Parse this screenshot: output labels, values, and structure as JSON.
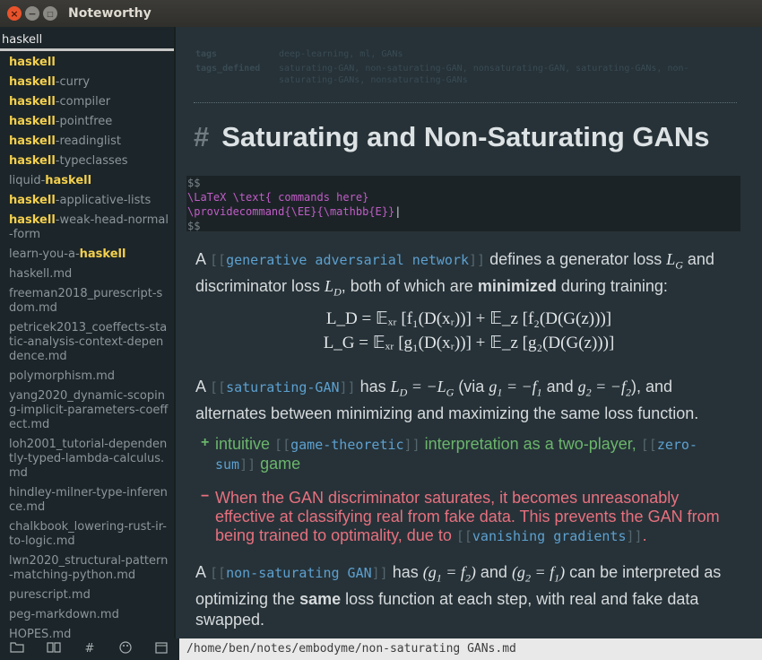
{
  "window": {
    "title": "Noteworthy"
  },
  "search": {
    "value": "haskell"
  },
  "files": [
    {
      "pre": "",
      "hl": "haskell",
      "post": ""
    },
    {
      "pre": "",
      "hl": "haskell",
      "post": "-curry"
    },
    {
      "pre": "",
      "hl": "haskell",
      "post": "-compiler"
    },
    {
      "pre": "",
      "hl": "haskell",
      "post": "-pointfree"
    },
    {
      "pre": "",
      "hl": "haskell",
      "post": "-readinglist"
    },
    {
      "pre": "",
      "hl": "haskell",
      "post": "-typeclasses"
    },
    {
      "pre": "liquid-",
      "hl": "haskell",
      "post": ""
    },
    {
      "pre": "",
      "hl": "haskell",
      "post": "-applicative-lists"
    },
    {
      "pre": "",
      "hl": "haskell",
      "post": "-weak-head-normal-form"
    },
    {
      "pre": "learn-you-a-",
      "hl": "haskell",
      "post": ""
    },
    {
      "pre": "haskell.md",
      "hl": "",
      "post": ""
    },
    {
      "pre": "freeman2018_purescript-sdom.md",
      "hl": "",
      "post": ""
    },
    {
      "pre": "petricek2013_coeffects-static-analysis-context-dependence.md",
      "hl": "",
      "post": ""
    },
    {
      "pre": "polymorphism.md",
      "hl": "",
      "post": ""
    },
    {
      "pre": "yang2020_dynamic-scoping-implicit-parameters-coeffect.md",
      "hl": "",
      "post": ""
    },
    {
      "pre": "loh2001_tutorial-dependently-typed-lambda-calculus.md",
      "hl": "",
      "post": ""
    },
    {
      "pre": "hindley-milner-type-inference.md",
      "hl": "",
      "post": ""
    },
    {
      "pre": "chalkbook_lowering-rust-ir-to-logic.md",
      "hl": "",
      "post": ""
    },
    {
      "pre": "lwn2020_structural-pattern-matching-python.md",
      "hl": "",
      "post": ""
    },
    {
      "pre": "purescript.md",
      "hl": "",
      "post": ""
    },
    {
      "pre": "peg-markdown.md",
      "hl": "",
      "post": ""
    },
    {
      "pre": "HOPES.md",
      "hl": "",
      "post": ""
    }
  ],
  "frontmatter": {
    "tags_key": "tags",
    "tags_val": "deep-learning, ml, GANs",
    "tags_defined_key": "tags_defined",
    "tags_defined_val": "saturating-GAN, non-saturating-GAN, nonsaturating-GAN, saturating-GANs, non-saturating-GANs, nonsaturating-GANs"
  },
  "heading": {
    "hash": "#",
    "text": "Saturating and Non-Saturating GANs"
  },
  "code": {
    "line1": "$$",
    "line2": "\\LaTeX \\text{ commands here}",
    "line3": "\\providecommand{\\EE}{\\mathbb{E}}",
    "line4": "$$"
  },
  "p1": {
    "a": "A ",
    "link_open": "[[",
    "link": "generative adversarial network",
    "link_close": "]]",
    "b": " defines a generator loss ",
    "m1": "L",
    "m1sub": "G",
    "c": " and discriminator loss ",
    "m2": "L",
    "m2sub": "D",
    "d": ", both of which are ",
    "bold": "minimized",
    "e": " during training:"
  },
  "eq1": "L_D = 𝔼ₓᵣ [f₁(D(xᵣ))] + 𝔼_z [f₂(D(G(z)))]",
  "eq2": "L_G = 𝔼ₓᵣ [g₁(D(xᵣ))] + 𝔼_z [g₂(D(G(z)))]",
  "p2": {
    "a": "A ",
    "link_open": "[[",
    "link": "saturating-GAN",
    "link_close": "]]",
    "b": " has ",
    "m": "L",
    "c": "(via ",
    "d": " and ",
    "e": "), and alternates between minimizing and maximizing the same loss function."
  },
  "bullet_plus": {
    "mark": "+",
    "a": "intuitive ",
    "link1": "game-theoretic",
    "b": " interpretation as a two-player, ",
    "link2": "zero-sum",
    "c": " game"
  },
  "bullet_minus": {
    "mark": "−",
    "a": "When the GAN discriminator saturates, it becomes unreasonably effective at classifying real from fake data.  This prevents the GAN from being trained to optimality, due to ",
    "link": "vanishing gradients",
    "b": "."
  },
  "p3": {
    "a": "A ",
    "link": "non-saturating GAN",
    "b": " has ",
    "c": " and ",
    "d": " can be interpreted as optimizing the ",
    "bold": "same",
    "e": " loss function at each step, with real and fake data swapped."
  },
  "statusbar": {
    "path": "/home/ben/notes/embodyme/non-saturating GANs.md"
  }
}
